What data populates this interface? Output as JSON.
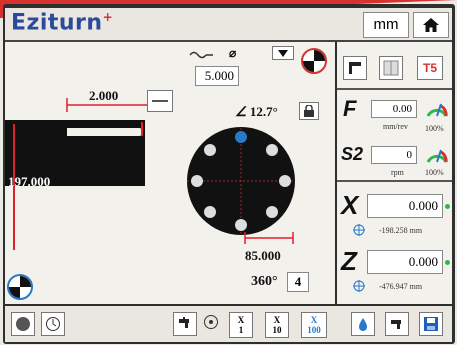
{
  "app": {
    "logo": "Eziturn",
    "logo_mark": "+",
    "units": "mm"
  },
  "main": {
    "dim_width": "2.000",
    "diameter_symbol": "⌀",
    "stock_diameter": "5.000",
    "dim_part": "197.000",
    "angle": "12.7°",
    "bolt_circle": "85.000",
    "full_angle": "360°",
    "hole_count": "4"
  },
  "right": {
    "tool_label": "T5",
    "feed_label": "F",
    "feed_value": "0.00",
    "feed_unit": "mm/rev",
    "feed_pct": "100%",
    "spindle_label": "S2",
    "spindle_value": "0",
    "spindle_unit": "rpm",
    "spindle_pct": "100%",
    "x_label": "X",
    "x_value": "0.000",
    "x_sub": "-198.258",
    "x_sub_unit": "mm",
    "z_label": "Z",
    "z_value": "0.000",
    "z_sub": "-476.947",
    "z_sub_unit": "mm"
  },
  "bottom": {
    "x1_top": "X",
    "x1_bottom": "1",
    "x10_top": "X",
    "x10_bottom": "10",
    "x100_top": "X",
    "x100_bottom": "100"
  },
  "colors": {
    "brand_blue": "#2a4b9c",
    "brand_red": "#d8322f",
    "accent_blue": "#2979c9",
    "dim_red": "#e0202a",
    "status_green": "#2db84a"
  }
}
